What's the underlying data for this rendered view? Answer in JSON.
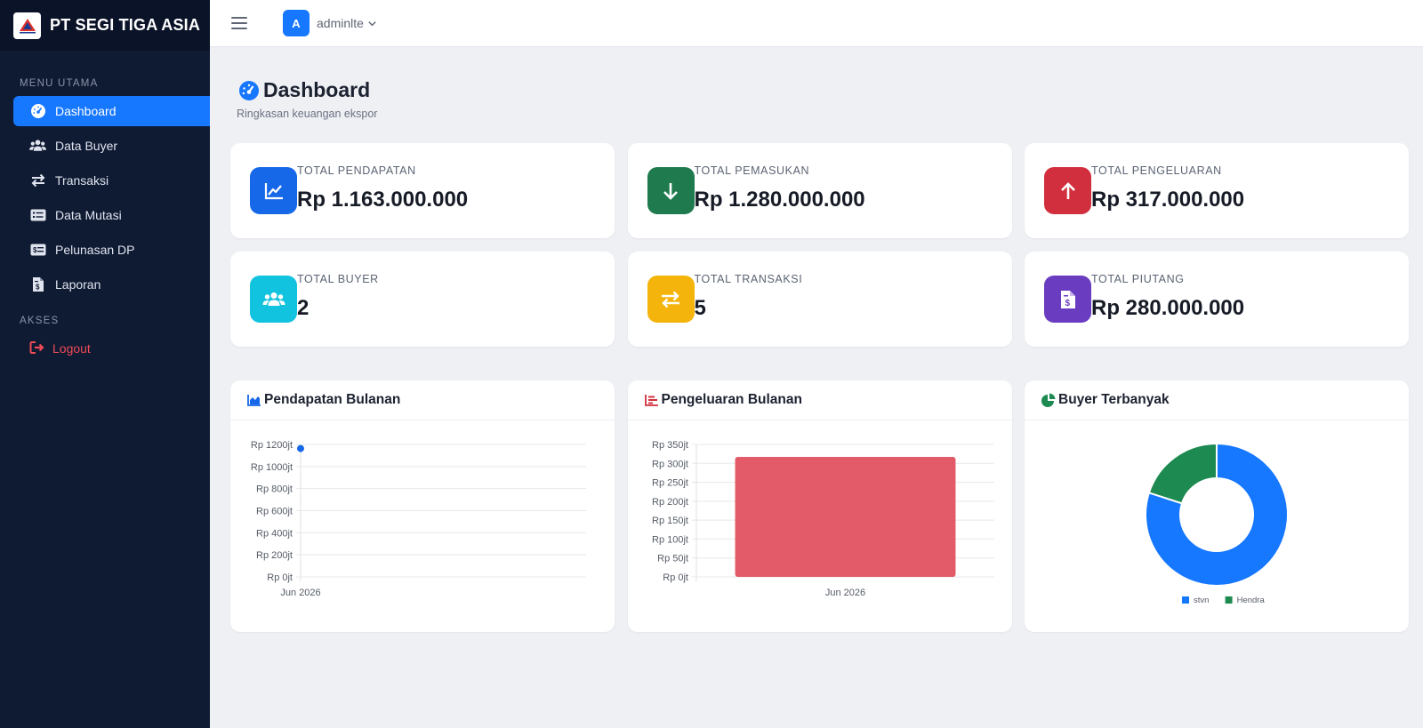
{
  "brand": {
    "name": "PT SEGI TIGA ASIA"
  },
  "sidebar": {
    "section_main": "MENU UTAMA",
    "items": [
      {
        "label": "Dashboard",
        "icon": "gauge-icon",
        "active": true
      },
      {
        "label": "Data Buyer",
        "icon": "users-icon",
        "active": false
      },
      {
        "label": "Transaksi",
        "icon": "arrows-exchange-icon",
        "active": false
      },
      {
        "label": "Data Mutasi",
        "icon": "list-card-icon",
        "active": false
      },
      {
        "label": "Pelunasan DP",
        "icon": "money-card-icon",
        "active": false
      },
      {
        "label": "Laporan",
        "icon": "file-invoice-icon",
        "active": false
      }
    ],
    "section_access": "AKSES",
    "logout_label": "Logout"
  },
  "header": {
    "avatar_letter": "A",
    "username": "adminlte"
  },
  "page": {
    "title": "Dashboard",
    "subtitle": "Ringkasan keuangan ekspor"
  },
  "stats": [
    {
      "label": "TOTAL PENDAPATAN",
      "value": "Rp 1.163.000.000",
      "icon": "chart-line-icon",
      "color": "#1668e8"
    },
    {
      "label": "TOTAL PEMASUKAN",
      "value": "Rp 1.280.000.000",
      "icon": "arrow-down-icon",
      "color": "#1f7a4d"
    },
    {
      "label": "TOTAL PENGELUARAN",
      "value": "Rp 317.000.000",
      "icon": "arrow-up-icon",
      "color": "#d22f3e"
    },
    {
      "label": "TOTAL BUYER",
      "value": "2",
      "icon": "users-icon",
      "color": "#12c3e0"
    },
    {
      "label": "TOTAL TRANSAKSI",
      "value": "5",
      "icon": "arrows-exchange-icon",
      "color": "#f4b40b"
    },
    {
      "label": "TOTAL PIUTANG",
      "value": "Rp 280.000.000",
      "icon": "file-invoice-icon",
      "color": "#6a3dc0"
    }
  ],
  "charts": {
    "income_title": "Pendapatan Bulanan",
    "expense_title": "Pengeluaran Bulanan",
    "buyer_title": "Buyer Terbanyak"
  },
  "chart_data": [
    {
      "type": "line",
      "title": "Pendapatan Bulanan",
      "x": [
        "Jun 2026"
      ],
      "series": [
        {
          "values": [
            1163
          ]
        }
      ],
      "ylim": [
        0,
        1200
      ],
      "yticks": [
        "Rp 0jt",
        "Rp 200jt",
        "Rp 400jt",
        "Rp 600jt",
        "Rp 800jt",
        "Rp 1000jt",
        "Rp 1200jt"
      ],
      "grid": true,
      "color": "#1668e8"
    },
    {
      "type": "bar",
      "title": "Pengeluaran Bulanan",
      "categories": [
        "Jun 2026"
      ],
      "values": [
        317
      ],
      "ylim": [
        0,
        350
      ],
      "yticks": [
        "Rp 0jt",
        "Rp 50jt",
        "Rp 100jt",
        "Rp 150jt",
        "Rp 200jt",
        "Rp 250jt",
        "Rp 300jt",
        "Rp 350jt"
      ],
      "grid": true,
      "color": "#e35b68"
    },
    {
      "type": "pie",
      "title": "Buyer Terbanyak",
      "donut": true,
      "categories": [
        "stvn",
        "Hendra"
      ],
      "values": [
        4,
        1
      ],
      "colors": [
        "#1677ff",
        "#1d8a52"
      ],
      "legend": "bottom"
    }
  ]
}
